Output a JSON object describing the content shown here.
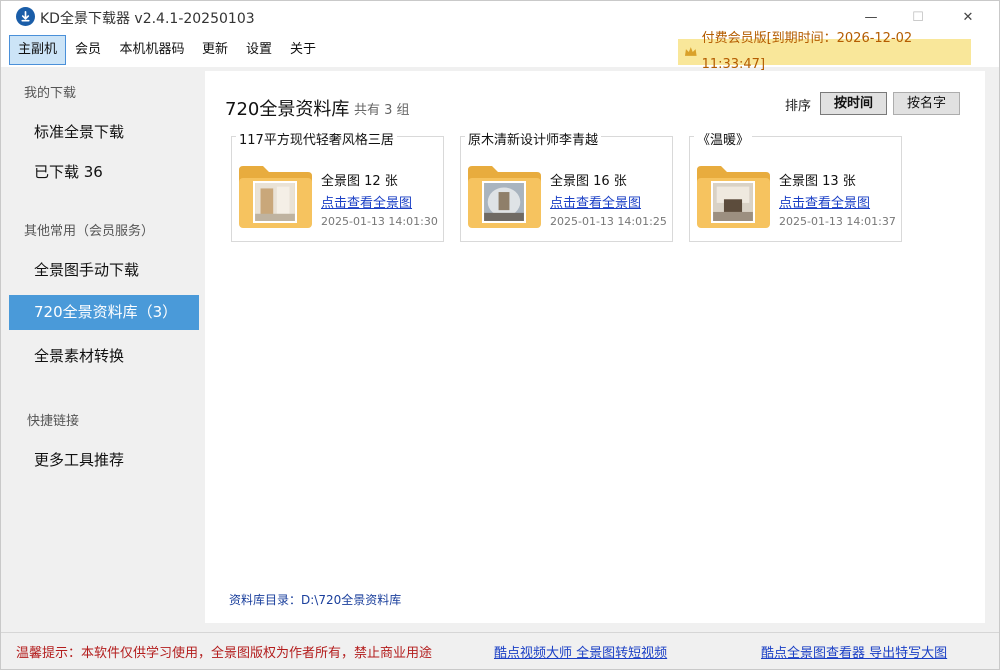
{
  "window": {
    "title": "KD全景下载器 v2.4.1-20250103",
    "min_glyph": "—",
    "max_glyph": "☐",
    "close_glyph": "✕"
  },
  "menu": {
    "items": [
      "主副机",
      "会员",
      "本机机器码",
      "更新",
      "设置",
      "关于"
    ],
    "vip_status": "付费会员版[到期时间：2026-12-02 11:33:47]"
  },
  "sidebar": {
    "heading_downloads": "我的下载",
    "standard_download": "标准全景下载",
    "downloaded": "已下载  36",
    "heading_common": "其他常用（会员服务）",
    "manual_download": "全景图手动下载",
    "library": "720全景资料库（3）",
    "convert": "全景素材转换",
    "heading_links": "快捷链接",
    "more_tools": "更多工具推荐"
  },
  "main": {
    "title": "720全景资料库",
    "count": "共有 3 组",
    "sort_label": "排序",
    "sort_by_time": "按时间",
    "sort_by_name": "按名字",
    "cards": [
      {
        "title": "117平方现代轻奢风格三居",
        "count": "全景图 12 张",
        "link": "点击查看全景图",
        "date": "2025-01-13 14:01:30"
      },
      {
        "title": "原木清新设计师李青越",
        "count": "全景图 16 张",
        "link": "点击查看全景图",
        "date": "2025-01-13 14:01:25"
      },
      {
        "title": "《温暖》",
        "count": "全景图 13 张",
        "link": "点击查看全景图",
        "date": "2025-01-13 14:01:37"
      }
    ],
    "library_dir": "资料库目录：D:\\720全景资料库"
  },
  "footer": {
    "warning": "温馨提示：本软件仅供学习使用，全景图版权为作者所有，禁止商业用途",
    "link_video": "酷点视频大师 全景图转短视频",
    "link_viewer": "酷点全景图查看器 导出特写大图"
  },
  "colors": {
    "accent": "#4a9ad9",
    "vip_bg": "#f9e79a",
    "vip_text": "#b45c00",
    "warning": "#b31d1d",
    "link": "#1a3fc5",
    "folder": "#f6c35f"
  },
  "icons": {
    "app": "download-circle-icon",
    "vip": "crown-icon",
    "folder": "folder-icon"
  }
}
